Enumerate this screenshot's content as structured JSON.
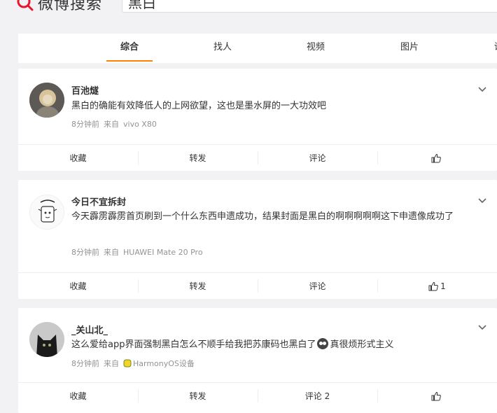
{
  "app": {
    "logo_text": "微博搜索"
  },
  "search": {
    "value": "黑白"
  },
  "tabs": [
    {
      "label": "综合",
      "active": true
    },
    {
      "label": "找人",
      "active": false
    },
    {
      "label": "视频",
      "active": false
    },
    {
      "label": "图片",
      "active": false
    },
    {
      "label": "话",
      "active": false
    }
  ],
  "posts": [
    {
      "user": "百池燧",
      "text": "黑白的确能有效降低人的上网欲望，这也是墨水屏的一大功效吧",
      "time": "8分钟前",
      "source_prefix": "来自",
      "source": "vivo X80",
      "actions": {
        "fav": "收藏",
        "repost": "转发",
        "comment": "评论",
        "like_count": ""
      }
    },
    {
      "user": "今日不宜拆封",
      "text": "今天霹雳霹雳首页刷到一个什么东西申遗成功，结果封面是黑白的啊啊啊啊啊这下申遗像成功了",
      "time": "8分钟前",
      "source_prefix": "来自",
      "source": "HUAWEI Mate 20 Pro",
      "actions": {
        "fav": "收藏",
        "repost": "转发",
        "comment": "评论",
        "like_count": "1"
      }
    },
    {
      "user": "_关山北_",
      "text_before": "这么爱给app界面强制黑白怎么不顺手给我把苏康码也黑白了",
      "text_after": "真很烦形式主义",
      "time": "8分钟前",
      "source_prefix": "来自",
      "source": "HarmonyOS设备",
      "actions": {
        "fav": "收藏",
        "repost": "转发",
        "comment": "评论 2",
        "like_count": ""
      }
    }
  ],
  "colors": {
    "accent": "#ff8200",
    "logo_red": "#e6162d",
    "meta": "#939393"
  }
}
